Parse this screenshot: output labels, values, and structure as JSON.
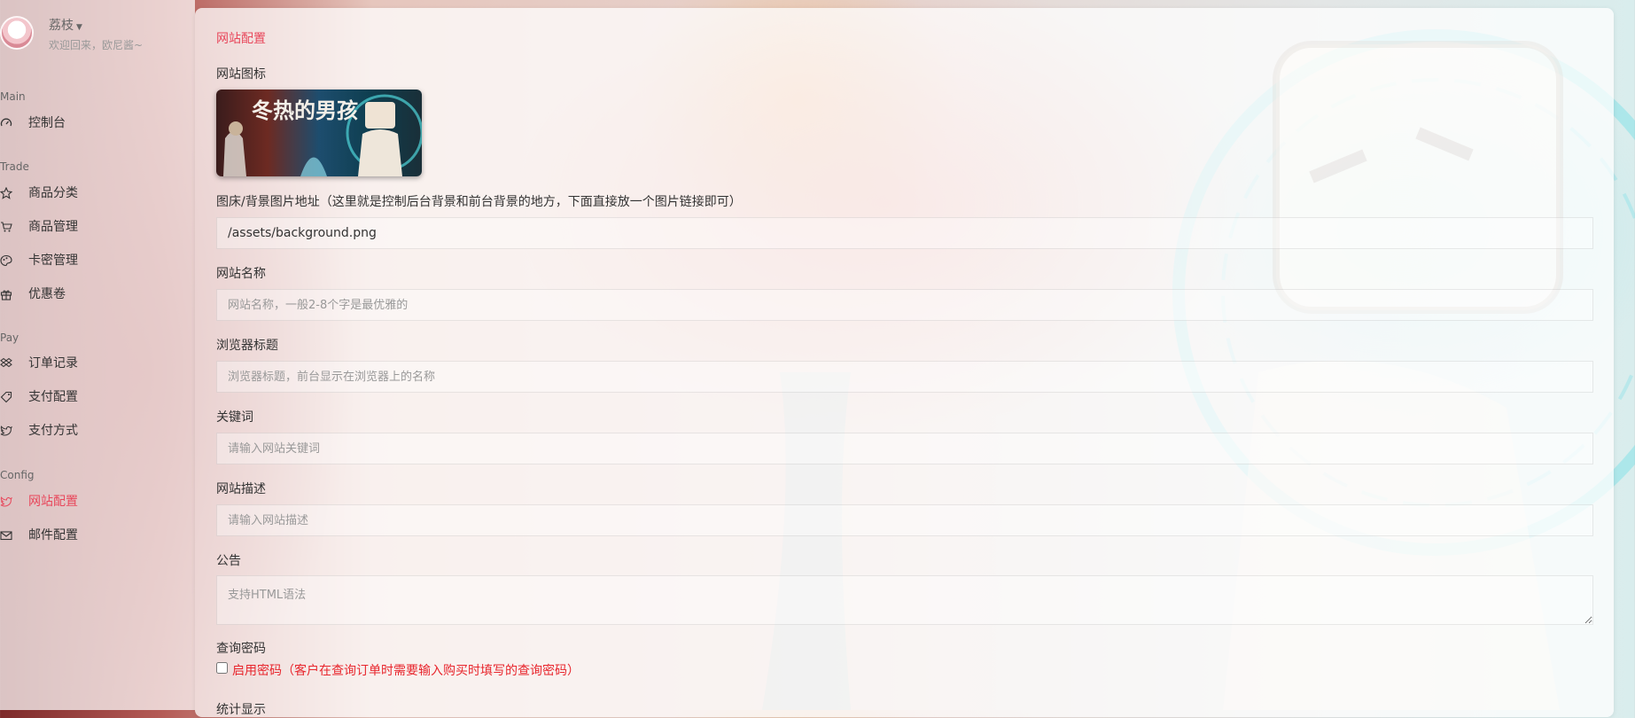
{
  "user": {
    "name": "荔枝",
    "welcome": "欢迎回来，欧尼酱~"
  },
  "sidebar": {
    "sections": [
      {
        "title": "Main",
        "items": [
          {
            "label": "控制台",
            "icon": "dashboard-gauge-icon"
          }
        ]
      },
      {
        "title": "Trade",
        "items": [
          {
            "label": "商品分类",
            "icon": "star-icon"
          },
          {
            "label": "商品管理",
            "icon": "cart-icon"
          },
          {
            "label": "卡密管理",
            "icon": "palette-icon"
          },
          {
            "label": "优惠卷",
            "icon": "gift-icon"
          }
        ]
      },
      {
        "title": "Pay",
        "items": [
          {
            "label": "订单记录",
            "icon": "dropbox-icon"
          },
          {
            "label": "支付配置",
            "icon": "tag-icon"
          },
          {
            "label": "支付方式",
            "icon": "twitter-bird-icon"
          }
        ]
      },
      {
        "title": "Config",
        "items": [
          {
            "label": "网站配置",
            "icon": "twitter-bird-icon",
            "active": true
          },
          {
            "label": "邮件配置",
            "icon": "envelope-icon"
          }
        ]
      }
    ]
  },
  "form": {
    "title": "网站配置",
    "icon_label": "网站图标",
    "logo_text": "冬热的男孩",
    "bg_label": "图床/背景图片地址（这里就是控制后台背景和前台背景的地方，下面直接放一个图片链接即可）",
    "bg_value": "/assets/background.png",
    "name_label": "网站名称",
    "name_placeholder": "网站名称，一般2-8个字是最优雅的",
    "browser_title_label": "浏览器标题",
    "browser_title_placeholder": "浏览器标题，前台显示在浏览器上的名称",
    "keywords_label": "关键词",
    "keywords_placeholder": "请输入网站关键词",
    "desc_label": "网站描述",
    "desc_placeholder": "请输入网站描述",
    "notice_label": "公告",
    "notice_placeholder": "支持HTML语法",
    "query_pwd_label": "查询密码",
    "query_pwd_checkbox": "启用密码（客户在查询订单时需要输入购买时填写的查询密码）",
    "stats_label": "统计显示"
  },
  "colors": {
    "accent": "#e8475b",
    "warning_text": "#e8262d"
  }
}
